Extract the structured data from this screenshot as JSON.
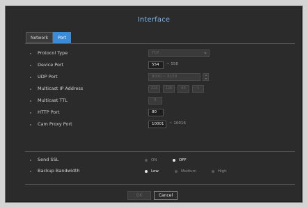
{
  "window": {
    "title": "Interface"
  },
  "tabs": [
    {
      "label": "Network",
      "active": false
    },
    {
      "label": "Port",
      "active": true
    }
  ],
  "fields": {
    "protocol_type": {
      "label": "Protocol Type",
      "value": "TCP"
    },
    "device_port": {
      "label": "Device Port",
      "value": "554",
      "range": "~ 558"
    },
    "udp_port": {
      "label": "UDP Port",
      "value": "8000 ~ 8159"
    },
    "multicast_ip": {
      "label": "Multicast IP Address",
      "octets": [
        "224",
        "126",
        "63",
        "1"
      ]
    },
    "multicast_ttl": {
      "label": "Multicast TTL",
      "value": "5"
    },
    "http_port": {
      "label": "HTTP Port",
      "value": "80"
    },
    "cam_proxy_port": {
      "label": "Cam Proxy Port",
      "value": "10001",
      "range": "~ 10016"
    }
  },
  "send_ssl": {
    "label": "Send SSL",
    "options": [
      {
        "label": "ON",
        "selected": false
      },
      {
        "label": "OFF",
        "selected": true
      }
    ]
  },
  "backup_bandwidth": {
    "label": "Backup Bandwidth",
    "options": [
      {
        "label": "Low",
        "selected": true
      },
      {
        "label": "Medium",
        "selected": false
      },
      {
        "label": "High",
        "selected": false
      }
    ]
  },
  "buttons": {
    "ok": "OK",
    "cancel": "Cancel"
  },
  "colors": {
    "accent": "#3a8bd8",
    "title": "#7fb2e6",
    "background": "#2b2b2b"
  }
}
